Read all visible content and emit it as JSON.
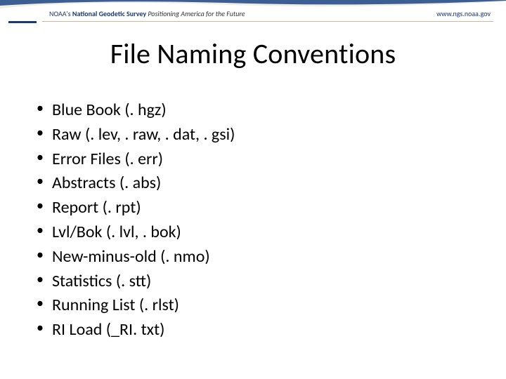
{
  "header": {
    "org": "NOAA's",
    "org_bold": "National Geodetic Survey",
    "tagline": "Positioning America for the Future",
    "url": "www.ngs.noaa.gov"
  },
  "title": "File Naming Conventions",
  "bullets": [
    "Blue Book (. hgz)",
    "Raw (. lev, . raw, . dat, . gsi)",
    "Error Files (. err)",
    "Abstracts (. abs)",
    "Report (. rpt)",
    "Lvl/Bok (. lvl, . bok)",
    "New-minus-old (. nmo)",
    "Statistics (. stt)",
    "Running List (. rlst)",
    "RI Load (_RI. txt)"
  ]
}
